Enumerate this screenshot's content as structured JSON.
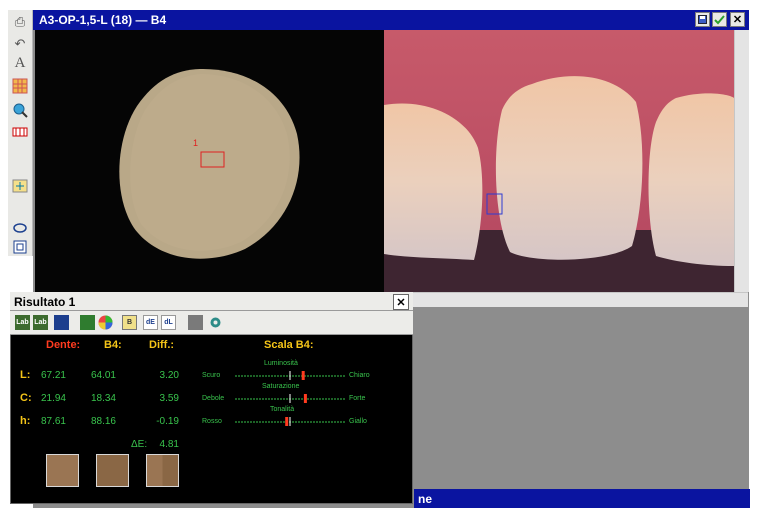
{
  "window": {
    "title": "A3-OP-1,5-L (18) — B4"
  },
  "bottom_bar": {
    "text": "ne"
  },
  "result_panel": {
    "title": "Risultato 1",
    "toolbar": [
      {
        "icon": "lab-icon",
        "label": "Lab"
      },
      {
        "icon": "lab-compare-icon",
        "label": "Lab"
      },
      {
        "icon": "grid-icon",
        "label": ""
      },
      {
        "icon": "list-icon",
        "label": ""
      },
      {
        "icon": "color-wheel-icon",
        "label": ""
      },
      {
        "icon": "shade-tab-icon",
        "label": ""
      },
      {
        "icon": "delta-e-icon",
        "label": "dE"
      },
      {
        "icon": "delta-l-icon",
        "label": "dL"
      },
      {
        "icon": "print-icon",
        "label": ""
      },
      {
        "icon": "settings-icon",
        "label": ""
      }
    ],
    "headers": {
      "dente": "Dente:",
      "b4": "B4:",
      "diff": "Diff.:",
      "scala": "Scala B4:"
    },
    "rows": [
      {
        "label": "L:",
        "dente": "67.21",
        "b4": "64.01",
        "diff": "3.20",
        "left": "Scuro",
        "title": "Luminosità",
        "right": "Chiaro",
        "marker": 0.62
      },
      {
        "label": "C:",
        "dente": "21.94",
        "b4": "18.34",
        "diff": "3.59",
        "left": "Debole",
        "title": "Saturazione",
        "right": "Forte",
        "marker": 0.64
      },
      {
        "label": "h:",
        "dente": "87.61",
        "b4": "88.16",
        "diff": "-0.19",
        "left": "Rosso",
        "title": "Tonalità",
        "right": "Giallo",
        "marker": 0.47
      }
    ],
    "delta_e": {
      "label": "ΔE:",
      "value": "4.81"
    }
  },
  "colors": {
    "accent_red": "#ff3b1f",
    "value_green": "#39c44d",
    "header_yellow": "#f5c518",
    "titlebar_blue": "#0a14a0"
  }
}
